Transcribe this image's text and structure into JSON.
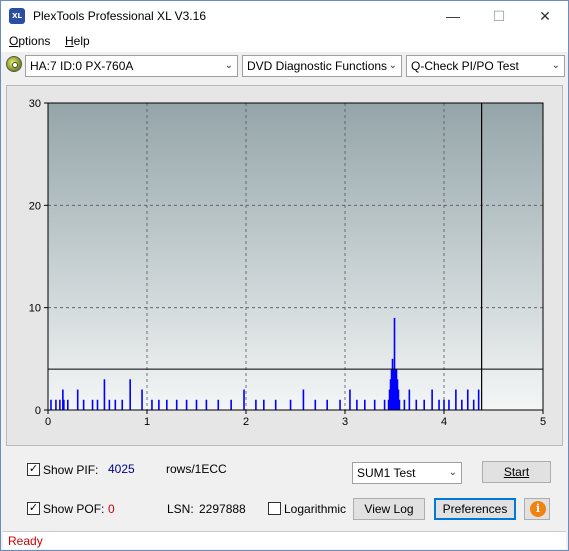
{
  "window": {
    "title": "PlexTools Professional XL V3.16",
    "icon_text": "XL",
    "minimize_glyph": "—",
    "maximize_glyph": "☐",
    "close_glyph": "✕"
  },
  "menu": {
    "items": [
      {
        "label": "Options",
        "accel": "O",
        "rest": "ptions"
      },
      {
        "label": "Help",
        "accel": "H",
        "rest": "elp"
      }
    ]
  },
  "toolbar": {
    "drive_select": "HA:7 ID:0  PX-760A",
    "function_select": "DVD Diagnostic Functions",
    "test_select": "Q-Check PI/PO Test",
    "drive_icon": "disc-drive-icon",
    "dropdown_glyph": "⌄"
  },
  "chart_data": {
    "type": "bar",
    "xlim": [
      0,
      5
    ],
    "ylim": [
      0,
      30
    ],
    "x_ticks": [
      "0",
      "1",
      "2",
      "3",
      "4",
      "5"
    ],
    "y_ticks": [
      "0",
      "10",
      "20",
      "30"
    ],
    "threshold_line": 4,
    "end_marker_x": 4.38,
    "grid": true,
    "series": [
      {
        "color": "#0000ff",
        "points": [
          [
            0.03,
            1
          ],
          [
            0.08,
            1
          ],
          [
            0.12,
            1
          ],
          [
            0.16,
            1
          ],
          [
            0.2,
            1
          ],
          [
            0.15,
            2
          ],
          [
            0.3,
            2
          ],
          [
            0.36,
            1
          ],
          [
            0.45,
            1
          ],
          [
            0.5,
            1
          ],
          [
            0.57,
            3
          ],
          [
            0.62,
            1
          ],
          [
            0.68,
            1
          ],
          [
            0.75,
            1
          ],
          [
            0.83,
            3
          ],
          [
            0.95,
            2
          ],
          [
            1.05,
            1
          ],
          [
            1.12,
            1
          ],
          [
            1.2,
            1
          ],
          [
            1.3,
            1
          ],
          [
            1.4,
            1
          ],
          [
            1.5,
            1
          ],
          [
            1.6,
            1
          ],
          [
            1.72,
            1
          ],
          [
            1.85,
            1
          ],
          [
            1.98,
            2
          ],
          [
            2.1,
            1
          ],
          [
            2.18,
            1
          ],
          [
            2.3,
            1
          ],
          [
            2.45,
            1
          ],
          [
            2.58,
            2
          ],
          [
            2.7,
            1
          ],
          [
            2.82,
            1
          ],
          [
            2.95,
            1
          ],
          [
            3.05,
            2
          ],
          [
            3.12,
            1
          ],
          [
            3.2,
            1
          ],
          [
            3.3,
            1
          ],
          [
            3.4,
            1
          ],
          [
            3.44,
            1
          ],
          [
            3.45,
            2
          ],
          [
            3.46,
            3
          ],
          [
            3.47,
            4
          ],
          [
            3.48,
            5
          ],
          [
            3.49,
            4
          ],
          [
            3.5,
            9
          ],
          [
            3.51,
            4
          ],
          [
            3.52,
            4
          ],
          [
            3.53,
            3
          ],
          [
            3.54,
            2
          ],
          [
            3.55,
            1
          ],
          [
            3.6,
            1
          ],
          [
            3.65,
            2
          ],
          [
            3.72,
            1
          ],
          [
            3.8,
            1
          ],
          [
            3.88,
            2
          ],
          [
            3.95,
            1
          ],
          [
            4.0,
            1
          ],
          [
            4.05,
            1
          ],
          [
            4.12,
            2
          ],
          [
            4.18,
            1
          ],
          [
            4.24,
            2
          ],
          [
            4.3,
            1
          ],
          [
            4.35,
            2
          ]
        ]
      }
    ]
  },
  "bottom": {
    "show_pif_label": "Show PIF:",
    "show_pif_checked": true,
    "pif_value": "4025",
    "rows_label": "rows/1ECC",
    "show_pof_label": "Show POF:",
    "show_pof_checked": true,
    "pof_value": "0",
    "lsn_label": "LSN:",
    "lsn_value": "2297888",
    "logarithmic_label": "Logarithmic",
    "logarithmic_checked": false,
    "sum_select": "SUM1 Test",
    "start_label": "Start",
    "view_log_label": "View Log",
    "preferences_label": "Preferences",
    "info_glyph": "i",
    "check_glyph": "✓"
  },
  "status": {
    "text": "Ready"
  },
  "colors": {
    "pif_value": "#000080",
    "pof_value": "#d00000",
    "status_text": "#d00000",
    "plot_top": "#94a5a9",
    "plot_bottom": "#f4f6f6",
    "bar": "#0000ff"
  }
}
